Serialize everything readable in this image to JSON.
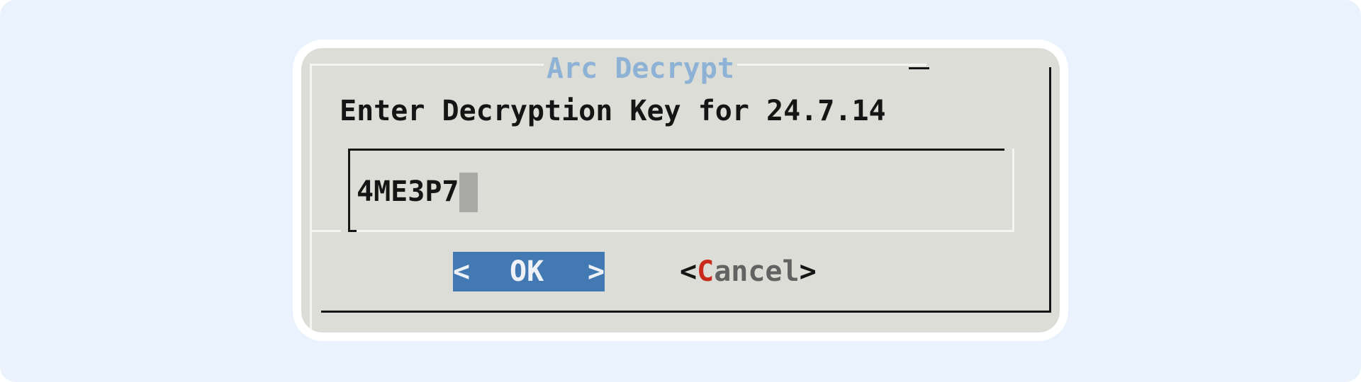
{
  "dialog": {
    "title": "Arc Decrypt",
    "prompt": "Enter Decryption Key for 24.7.14"
  },
  "input": {
    "value": "4ME3P7"
  },
  "buttons": {
    "ok": {
      "left_bracket": "<",
      "label": "OK",
      "right_bracket": ">"
    },
    "cancel": {
      "left_bracket": "<",
      "hotkey": "C",
      "label_rest": "ancel",
      "right_bracket": ">"
    }
  },
  "colors": {
    "background": "#eaf3fd",
    "dialog_bg": "#dcddd7",
    "title_color": "#8db2d6",
    "selected_button_bg": "#4279b2",
    "hotkey_color": "#c92a1b"
  }
}
